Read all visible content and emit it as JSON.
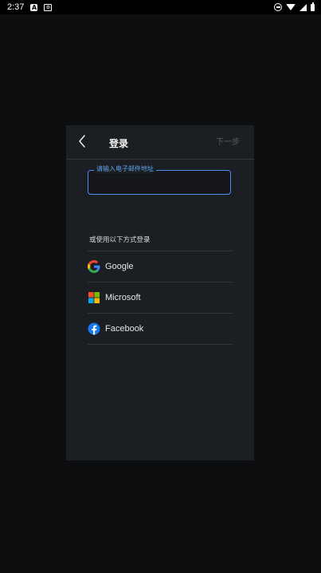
{
  "status_bar": {
    "time": "2:37",
    "left_icons": [
      "a-box-icon",
      "gear-box-icon"
    ],
    "right_icons": [
      "do-not-disturb-icon",
      "wifi-icon",
      "signal-icon",
      "battery-icon"
    ]
  },
  "dialog": {
    "title": "登录",
    "next_label": "下一步",
    "email": {
      "label": "请输入电子邮件地址",
      "value": ""
    },
    "alt_login_label": "或使用以下方式登录",
    "providers": [
      {
        "label": "Google",
        "icon": "google-icon"
      },
      {
        "label": "Microsoft",
        "icon": "microsoft-icon"
      },
      {
        "label": "Facebook",
        "icon": "facebook-icon"
      }
    ]
  },
  "colors": {
    "background": "#0d0e10",
    "dialog_background": "#1b1e22",
    "accent": "#4b8fe6",
    "divider": "#34383e",
    "disabled_text": "#5a5e64",
    "facebook_blue": "#1877f2"
  }
}
